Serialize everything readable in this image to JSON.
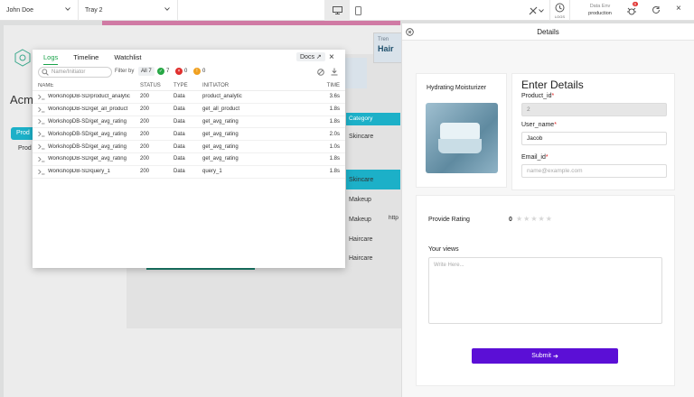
{
  "topbar": {
    "user": "John Doe",
    "tray": "Tray 2",
    "logs_label": "LOGS",
    "env_label": "Data Env",
    "env_value": "production",
    "notif_count": "0"
  },
  "bg": {
    "acme": "Acm",
    "sidebar_pill": "Prod",
    "sidebar_text": "Prod",
    "trend_label": "Tren",
    "trend_value": "Hair",
    "categories": [
      "Category",
      "Skincare",
      "Skincare",
      "Makeup",
      "Makeup",
      "Haircare",
      "Haircare"
    ],
    "row_extra": "http"
  },
  "logs": {
    "tabs": [
      "Logs",
      "Timeline",
      "Watchlist"
    ],
    "docs": "Docs",
    "search_placeholder": "Name/Initiator",
    "filter_by": "Filter by",
    "counts": {
      "all": "All 7",
      "ok": "7",
      "err": "0",
      "warn": "0"
    },
    "columns": [
      "NAME",
      "STATUS",
      "TYPE",
      "INITIATOR",
      "TIME"
    ],
    "rows": [
      {
        "name": "WorkshopDB-SD/product_analytic",
        "status": "200",
        "type": "Data",
        "initiator": "product_analytic",
        "time": "3.6s"
      },
      {
        "name": "WorkshopDB-SD/get_all_product",
        "status": "200",
        "type": "Data",
        "initiator": "get_all_product",
        "time": "1.8s"
      },
      {
        "name": "WorkshopDB-SD/get_avg_rating",
        "status": "200",
        "type": "Data",
        "initiator": "get_avg_rating",
        "time": "1.8s"
      },
      {
        "name": "WorkshopDB-SD/get_avg_rating",
        "status": "200",
        "type": "Data",
        "initiator": "get_avg_rating",
        "time": "2.0s"
      },
      {
        "name": "WorkshopDB-SD/get_avg_rating",
        "status": "200",
        "type": "Data",
        "initiator": "get_avg_rating",
        "time": "1.0s"
      },
      {
        "name": "WorkshopDB-SD/get_avg_rating",
        "status": "200",
        "type": "Data",
        "initiator": "get_avg_rating",
        "time": "1.8s"
      },
      {
        "name": "WorkshopDB-SD/query_1",
        "status": "200",
        "type": "Data",
        "initiator": "query_1",
        "time": "1.8s"
      }
    ]
  },
  "details": {
    "title": "Details",
    "product_name": "Hydrating Moisturizer",
    "form_title": "Enter Details",
    "product_id_label": "Product_id",
    "product_id_value": "2",
    "user_name_label": "User_name",
    "user_name_value": "Jacob",
    "email_label": "Email_id",
    "email_placeholder": "name@example.com",
    "rating_label": "Provide Rating",
    "rating_value": "0",
    "views_label": "Your views",
    "views_placeholder": "Write Here...",
    "submit": "Submit"
  },
  "colors": {
    "accent_green": "#1aa34a",
    "submit": "#5b0fd6",
    "teal": "#1cb0c8",
    "pink": "#d07aa4",
    "required": "#e02020"
  }
}
